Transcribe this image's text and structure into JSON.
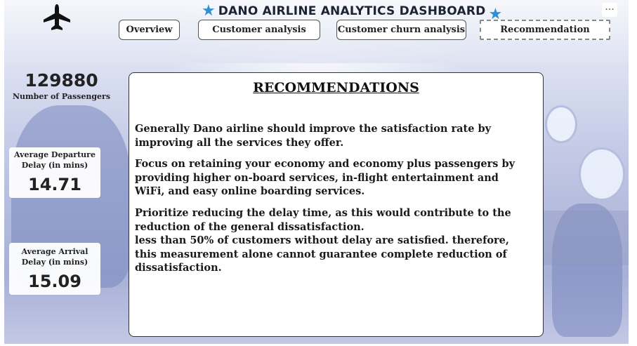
{
  "header": {
    "title": "DANO AIRLINE ANALYTICS DASHBOARD",
    "more_label": "···"
  },
  "tabs": [
    {
      "label": "Overview"
    },
    {
      "label": "Customer analysis"
    },
    {
      "label": "Customer churn analysis"
    },
    {
      "label": "Recommendation"
    }
  ],
  "kpis": {
    "passengers": {
      "value": "129880",
      "label": "Number of Passengers"
    },
    "departure_delay": {
      "value": "14.71",
      "label_line1": "Average Departure",
      "label_line2": "Delay (in mins)"
    },
    "arrival_delay": {
      "value": "15.09",
      "label_line1": "Average Arrival",
      "label_line2": "Delay (in mins)"
    }
  },
  "recommendations": {
    "title": "RECOMMENDATIONS",
    "p1": "Generally Dano airline should improve the satisfaction rate by improving all the services they offer.",
    "p2": "Focus on retaining your economy and economy plus passengers by providing higher on-board services, in-flight entertainment and WiFi, and easy online boarding services.",
    "p3": "Prioritize reducing the delay time, as this would contribute to the reduction of the general dissatisfaction.",
    "p4": "less than 50% of customers without delay are satisfied. therefore, this measurement alone cannot guarantee complete reduction of dissatisfaction."
  },
  "colors": {
    "accent_star": "#2f8fd6",
    "background": "#b9c0e0"
  },
  "icons": {
    "logo": "airplane-icon",
    "title_decoration": "star-icon",
    "menu": "more-options-icon"
  }
}
